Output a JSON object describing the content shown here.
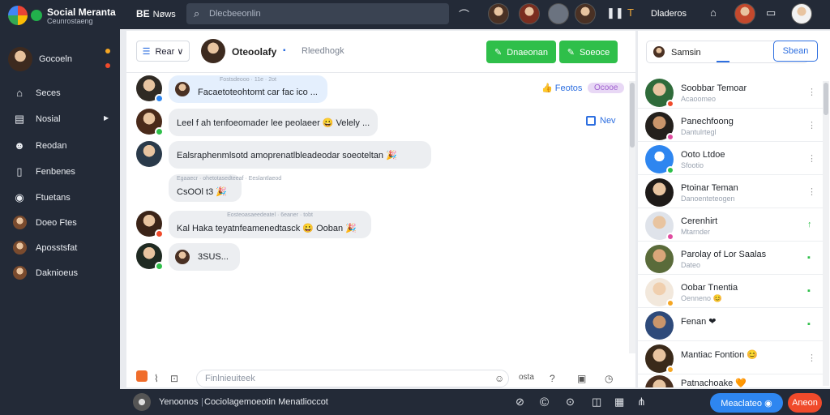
{
  "app": {
    "name": "Social Meranta",
    "subtitle": "Ceunrostaeng",
    "top_news": "Nøws",
    "top_news_icon": "BE",
    "search_placeholder": "Dlecbeeonlin",
    "top_right_label": "Dladeros"
  },
  "sidebar": {
    "profile_name": "Gocoeln",
    "items": [
      {
        "icon": "home-icon",
        "label": "Seces"
      },
      {
        "icon": "flag-icon",
        "label": "Nosial"
      },
      {
        "icon": "user-icon",
        "label": "Reodan"
      },
      {
        "icon": "tablet-icon",
        "label": "Fenbenes"
      },
      {
        "icon": "record-icon",
        "label": "Ftuetans"
      },
      {
        "icon": "avatar-icon",
        "label": "Doeo Ftes"
      },
      {
        "icon": "avatar-icon",
        "label": "Aposstsfat"
      },
      {
        "icon": "avatar-icon",
        "label": "Daknioeus"
      }
    ]
  },
  "chat": {
    "filter_label": "Rear",
    "filter_caret": "∨",
    "header_name": "Oteoolafy",
    "header_mark": "▪",
    "header_sub": "Rleedhogk",
    "btn_primary": "Dnaeonan",
    "btn_secondary": "Soeoce",
    "tag_right": "Feotos",
    "tag_pill": "Ocooe",
    "tag_new": "Nev",
    "messages": [
      {
        "meta": "Fostsdeooo · 11e · 2ot",
        "text": "Facaetoteohtomt car fac ico ..."
      },
      {
        "meta": "",
        "text": "Leel f ah tenfoeomader lee peolaeer 😀 Velely ..."
      },
      {
        "meta": "",
        "text": "Ealsraphenmlsotd amoprenatlbleadeodar soeoteltan 🎉"
      },
      {
        "meta": "Egaaecr · ohetotasedteeaf · Eeslantlaeod",
        "text": "CsOOl t3 🎉"
      },
      {
        "meta": "Eosteoasaeedeatel · 6eaner · tobt",
        "text": "Kal Haka teyatnfeamenedtasck 😀 Ooban 🎉"
      },
      {
        "meta": "",
        "text": "3SUS..."
      }
    ],
    "composer_placeholder": "Finlnieuiteek",
    "composer_icon_label": "osta"
  },
  "right": {
    "search_label": "Samsin",
    "button_label": "Sbean",
    "contacts": [
      {
        "name": "Soobbar Temoar",
        "sub": "Acaoomeo",
        "action": "⋮"
      },
      {
        "name": "Panechfoong",
        "sub": "Dantulrtegl",
        "action": "⋮"
      },
      {
        "name": "Ooto Ltdoe",
        "sub": "Sfootio",
        "action": "⋮"
      },
      {
        "name": "Ptoinar Teman",
        "sub": "Danoenteteogen",
        "action": "⋮"
      },
      {
        "name": "Cerenhirt",
        "sub": "Mtarnder",
        "action": "↑"
      },
      {
        "name": "Parolay of Lor Saalas",
        "sub": "Dateo",
        "action": "▪"
      },
      {
        "name": "Oobar Tnentia",
        "sub": "Oenneno 😊",
        "action": "▪"
      },
      {
        "name": "Fenan ❤",
        "sub": "",
        "action": "▪"
      },
      {
        "name": "Mantiac Fontion 😊",
        "sub": "",
        "action": "⋮"
      },
      {
        "name": "Patnachoake 🧡",
        "sub": "",
        "action": ""
      }
    ]
  },
  "bottom": {
    "label_left": "Yenoonos",
    "label_mid": "Cociolagemoeotin Menatlioccot",
    "btn_blue": "Meaclateo",
    "btn_red": "Aneon"
  },
  "colors": {
    "dark": "#232a37",
    "accent_blue": "#2e6fe0",
    "accent_green": "#2fbf4a",
    "accent_red": "#f04a2b"
  }
}
